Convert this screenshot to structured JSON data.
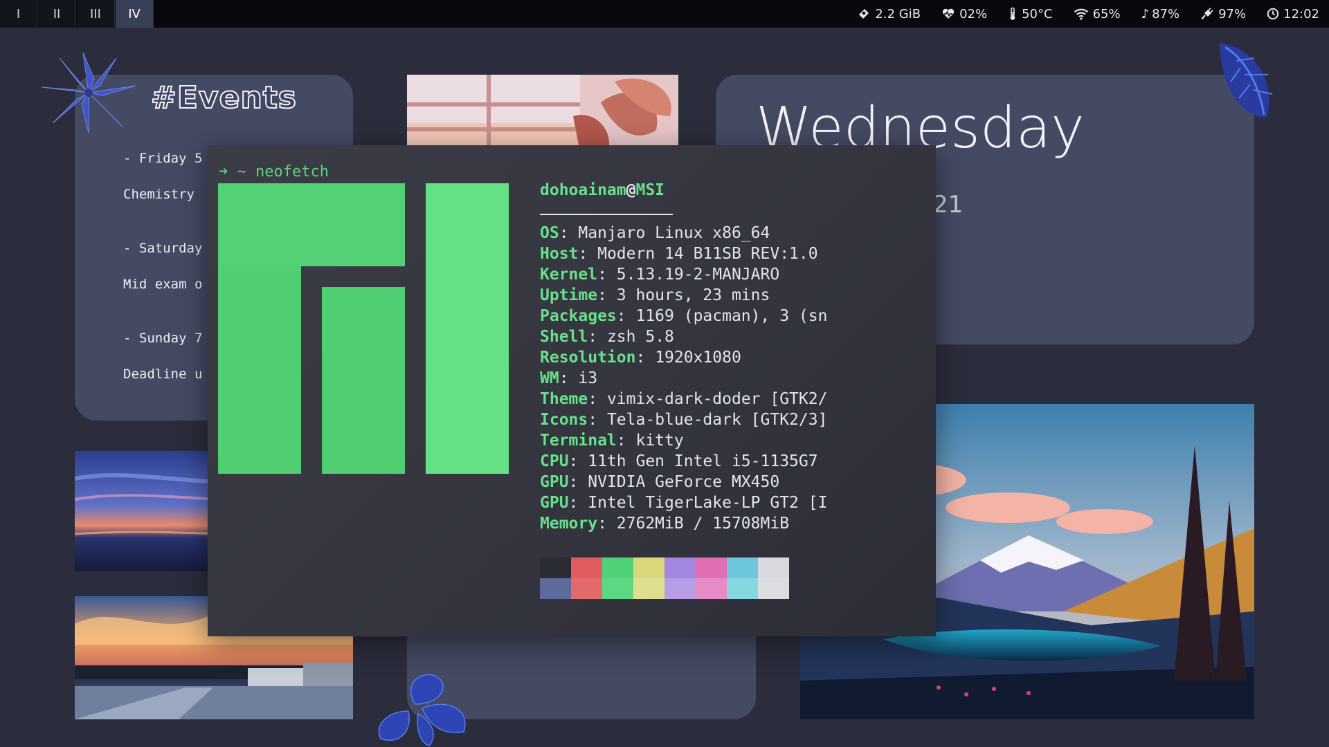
{
  "topbar": {
    "workspaces": [
      {
        "label": "I",
        "active": false
      },
      {
        "label": "II",
        "active": false
      },
      {
        "label": "III",
        "active": false
      },
      {
        "label": "IV",
        "active": true
      }
    ],
    "status": {
      "memory": {
        "icon": "memory-icon",
        "value": "2.2 GiB"
      },
      "cpu": {
        "icon": "heartbeat-icon",
        "value": "02%"
      },
      "temperature": {
        "icon": "thermometer-icon",
        "value": "50°C"
      },
      "wifi": {
        "icon": "wifi-icon",
        "value": "65%"
      },
      "volume": {
        "icon": "music-note-icon",
        "value": "87%"
      },
      "battery": {
        "icon": "plug-icon",
        "value": "97%"
      },
      "clock": {
        "icon": "clock-icon",
        "value": "12:02"
      }
    }
  },
  "events": {
    "title": "#Events",
    "lines": [
      "- Friday 5",
      "Chemistry",
      "- Saturday",
      "Mid exam o",
      "- Sunday 7",
      "Deadline u"
    ]
  },
  "date_card": {
    "weekday": "Wednesday",
    "date_fragment": "21"
  },
  "terminal": {
    "prompt_arrow": "➜",
    "prompt_dir": "~",
    "command": "neofetch",
    "user": "dohoainam",
    "at": "@",
    "host": "MSI",
    "info": [
      {
        "key": "OS",
        "value": "Manjaro Linux x86_64"
      },
      {
        "key": "Host",
        "value": "Modern 14 B11SB REV:1.0"
      },
      {
        "key": "Kernel",
        "value": "5.13.19-2-MANJARO"
      },
      {
        "key": "Uptime",
        "value": "3 hours, 23 mins"
      },
      {
        "key": "Packages",
        "value": "1169 (pacman), 3 (sn"
      },
      {
        "key": "Shell",
        "value": "zsh 5.8"
      },
      {
        "key": "Resolution",
        "value": "1920x1080"
      },
      {
        "key": "WM",
        "value": "i3"
      },
      {
        "key": "Theme",
        "value": "vimix-dark-doder [GTK2/"
      },
      {
        "key": "Icons",
        "value": "Tela-blue-dark [GTK2/3]"
      },
      {
        "key": "Terminal",
        "value": "kitty"
      },
      {
        "key": "CPU",
        "value": "11th Gen Intel i5-1135G7"
      },
      {
        "key": "GPU",
        "value": "NVIDIA GeForce MX450"
      },
      {
        "key": "GPU",
        "value": "Intel TigerLake-LP GT2 [I"
      },
      {
        "key": "Memory",
        "value": "2762MiB / 15708MiB"
      }
    ],
    "palette_top": [
      "#2a2b33",
      "#e05d5d",
      "#4fd178",
      "#d8d77a",
      "#a386e0",
      "#e06eb3",
      "#6dc6dc",
      "#d8d9de"
    ],
    "palette_bottom": [
      "#5f6a9c",
      "#e36a6a",
      "#5cd884",
      "#dfde8e",
      "#b79ce8",
      "#e58cc6",
      "#86d8e0",
      "#dcdde1"
    ]
  },
  "colors": {
    "background": "#2b2d3c",
    "card": "#454a63",
    "accent_green": "#58d57a",
    "topbar": "#08090d"
  }
}
